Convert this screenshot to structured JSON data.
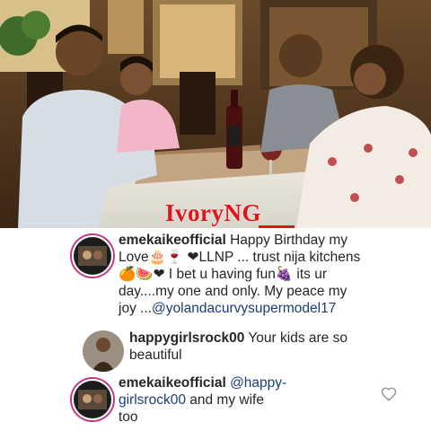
{
  "watermark": "IvoryNG",
  "comments": [
    {
      "username": "emekaikeofficial",
      "text_line1": " Happy Birthday my",
      "text_line2": "Love🎂🍷 ❤LLNP ... trust nija kitchens",
      "text_line3": "🍊🍉❤ I bet u having fun🍇 its ur",
      "text_line4": "day....my  one and only. My peace my",
      "text_line5_prefix": "joy ...",
      "mention": "@yolandacurvysupermodel17"
    },
    {
      "username": "happygirlsrock00",
      "text_line1": " Your kids are so",
      "text_line2": "beautiful"
    },
    {
      "username": "emekaikeofficial",
      "mention_line1": " @happy-",
      "mention_line2": "girlsrock00",
      "text_line2": "  and my wife",
      "text_line3": "too"
    }
  ],
  "icons": {
    "like": "heart-icon"
  }
}
